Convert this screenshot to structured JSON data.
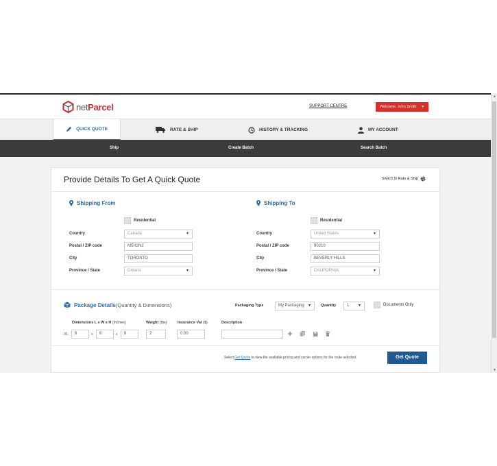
{
  "header": {
    "logo_net": "net",
    "logo_parcel": "Parcel",
    "support_label": "SUPPORT CENTRE",
    "welcome_label": "Welcome, John Smith",
    "brand_color": "#c5312b",
    "accent_color": "#2a6ea8"
  },
  "nav": {
    "items": [
      {
        "label": "QUICK QUOTE",
        "icon": "pencil-icon"
      },
      {
        "label": "RATE & SHIP",
        "icon": "truck-icon"
      },
      {
        "label": "HISTORY & TRACKING",
        "icon": "clock-icon"
      },
      {
        "label": "MY ACCOUNT",
        "icon": "user-icon"
      }
    ]
  },
  "subnav": {
    "items": [
      "Ship",
      "Create Batch",
      "Search Batch"
    ]
  },
  "form": {
    "title": "Provide Details To Get A Quick Quote",
    "switch_label": "Switch to Rate & Ship",
    "from": {
      "title": "Shipping From",
      "residential": "Residential",
      "country_label": "Country",
      "country": "Canada",
      "postal_label": "Postal / ZIP code",
      "postal": "M5H2N2",
      "city_label": "City",
      "city": "TORONTO",
      "province_label": "Province / State",
      "province": "Ontario"
    },
    "to": {
      "title": "Shipping To",
      "residential": "Residential",
      "country_label": "Country",
      "country": "United States",
      "postal_label": "Postal / ZIP code",
      "postal": "90210",
      "city_label": "City",
      "city": "BEVERLY HILLS",
      "province_label": "Province / State",
      "province": "CALIFORNIA"
    },
    "package": {
      "title": "Package Details",
      "subtitle": "(Quantity & Dimensions)",
      "packaging_label": "Packaging Type",
      "packaging": "My Packaging",
      "quantity_label": "Quantity",
      "quantity": "1",
      "documents_label": "Documents Only",
      "dims_label": "Dimensions L x W x H",
      "dims_unit": "(Inches)",
      "weight_label": "Weight",
      "weight_unit": "(lbs)",
      "insurance_label": "Insurance Val",
      "insurance_unit": "($)",
      "description_label": "Description",
      "row_index": "01.",
      "times": "x",
      "length": "6",
      "width": "6",
      "height": "6",
      "weight": "2",
      "insurance": "0.00",
      "description": ""
    },
    "footer": {
      "text_before": "Select ",
      "link": "Get Quote",
      "text_after": " to view the available pricing and carrier options for the route selected.",
      "button": "Get Quote"
    }
  }
}
